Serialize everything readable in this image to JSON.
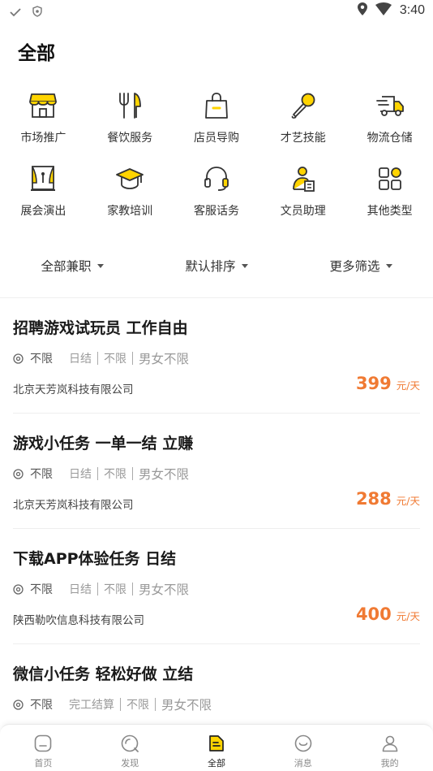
{
  "status_bar": {
    "time": "3:40"
  },
  "page_title": "全部",
  "categories": [
    {
      "label": "市场推广",
      "icon": "shop-icon"
    },
    {
      "label": "餐饮服务",
      "icon": "fork-knife-icon"
    },
    {
      "label": "店员导购",
      "icon": "shopping-bag-icon"
    },
    {
      "label": "才艺技能",
      "icon": "microphone-icon"
    },
    {
      "label": "物流仓储",
      "icon": "truck-icon"
    },
    {
      "label": "展会演出",
      "icon": "stage-icon"
    },
    {
      "label": "家教培训",
      "icon": "graduation-cap-icon"
    },
    {
      "label": "客服话务",
      "icon": "headset-icon"
    },
    {
      "label": "文员助理",
      "icon": "clerk-icon"
    },
    {
      "label": "其他类型",
      "icon": "grid-icon"
    }
  ],
  "filters": [
    {
      "label": "全部兼职"
    },
    {
      "label": "默认排序"
    },
    {
      "label": "更多筛选"
    }
  ],
  "jobs": [
    {
      "title": "招聘游戏试玩员 工作自由",
      "location": "不限",
      "settlement": "日结",
      "time": "不限",
      "gender": "男女不限",
      "company": "北京天芳岚科技有限公司",
      "price": "399",
      "unit": "元/天"
    },
    {
      "title": "游戏小任务  一单一结 立赚",
      "location": "不限",
      "settlement": "日结",
      "time": "不限",
      "gender": "男女不限",
      "company": "北京天芳岚科技有限公司",
      "price": "288",
      "unit": "元/天"
    },
    {
      "title": "下载APP体验任务  日结",
      "location": "不限",
      "settlement": "日结",
      "time": "不限",
      "gender": "男女不限",
      "company": "陕西勒吹信息科技有限公司",
      "price": "400",
      "unit": "元/天"
    },
    {
      "title": "微信小任务  轻松好做 立结",
      "location": "不限",
      "settlement": "完工结算",
      "time": "不限",
      "gender": "男女不限",
      "company": "",
      "price": "",
      "unit": ""
    }
  ],
  "bottom_nav": [
    {
      "label": "首页",
      "icon": "home-icon",
      "active": false
    },
    {
      "label": "发现",
      "icon": "discover-icon",
      "active": false
    },
    {
      "label": "全部",
      "icon": "all-icon",
      "active": true
    },
    {
      "label": "消息",
      "icon": "message-icon",
      "active": false
    },
    {
      "label": "我的",
      "icon": "profile-icon",
      "active": false
    }
  ],
  "colors": {
    "accent": "#f07a33",
    "icon_yellow": "#ffd400",
    "icon_stroke": "#333333"
  }
}
